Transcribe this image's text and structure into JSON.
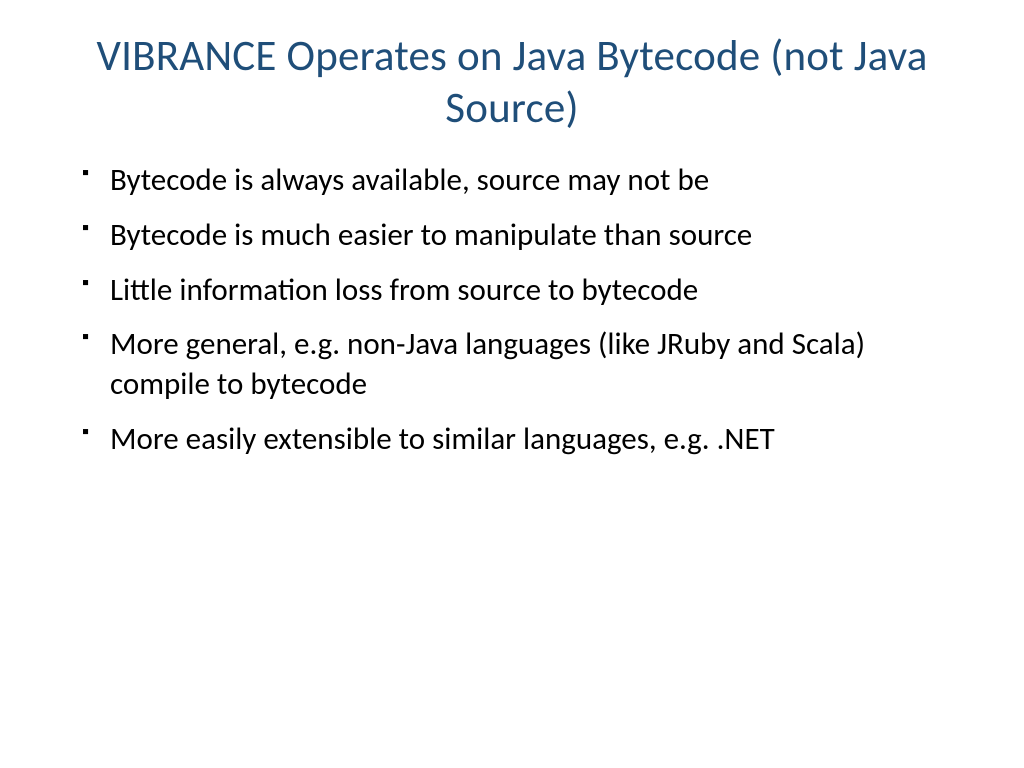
{
  "slide": {
    "title": "VIBRANCE Operates on Java Bytecode (not Java Source)",
    "bullets": [
      "Bytecode is always available, source may not be",
      "Bytecode is much easier to manipulate than source",
      "Little information loss from source to bytecode",
      "More general, e.g. non-Java languages (like JRuby and Scala) compile to bytecode",
      "More easily extensible to similar languages, e.g. .NET"
    ]
  }
}
